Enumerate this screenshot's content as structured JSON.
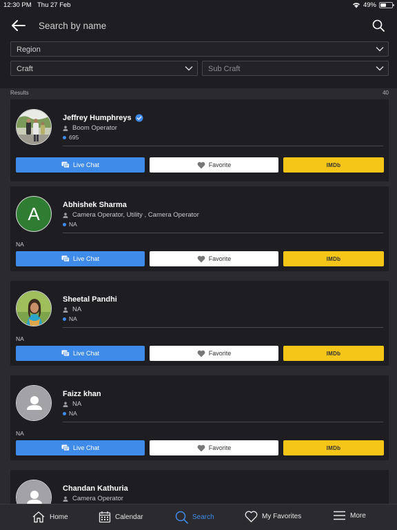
{
  "status_bar": {
    "time": "12:30 PM",
    "date": "Thu 27 Feb",
    "battery": "49%",
    "battery_level": 0.49
  },
  "header": {
    "search_placeholder": "Search by name"
  },
  "filters": {
    "region": "Region",
    "craft": "Craft",
    "sub_craft": "Sub Craft"
  },
  "results": {
    "label": "Results",
    "count": "40"
  },
  "buttons": {
    "chat": "Live Chat",
    "favorite": "Favorite",
    "imdb": "IMDb"
  },
  "people": [
    {
      "name": "Jeffrey Humphreys",
      "verified": true,
      "craft": "Boom Operator",
      "count": "695",
      "note": "",
      "avatar": "photo-outdoor"
    },
    {
      "name": "Abhishek Sharma",
      "verified": false,
      "craft": "Camera Operator, Utility , Camera Operator",
      "count": "NA",
      "note": "NA",
      "avatar": "letter",
      "initial": "A",
      "avatar_color": "#2e7d32"
    },
    {
      "name": "Sheetal Pandhi",
      "verified": false,
      "craft": "NA",
      "count": "NA",
      "note": "NA",
      "avatar": "photo-woman"
    },
    {
      "name": "Faizz khan",
      "verified": false,
      "craft": "NA",
      "count": "NA",
      "note": "NA",
      "avatar": "placeholder"
    },
    {
      "name": "Chandan Kathuria",
      "verified": false,
      "craft": "Camera Operator",
      "count": "",
      "note": "",
      "avatar": "placeholder"
    }
  ],
  "tabs": [
    {
      "label": "Home",
      "icon": "home-icon"
    },
    {
      "label": "Calendar",
      "icon": "calendar-icon"
    },
    {
      "label": "Search",
      "icon": "search-icon",
      "active": true
    },
    {
      "label": "My Favorites",
      "icon": "heart-icon"
    },
    {
      "label": "More",
      "icon": "menu-icon"
    }
  ],
  "colors": {
    "accent": "#3f8bea",
    "imdb": "#f5c518",
    "background": "#2b2b2f",
    "card": "#1e1e22"
  }
}
